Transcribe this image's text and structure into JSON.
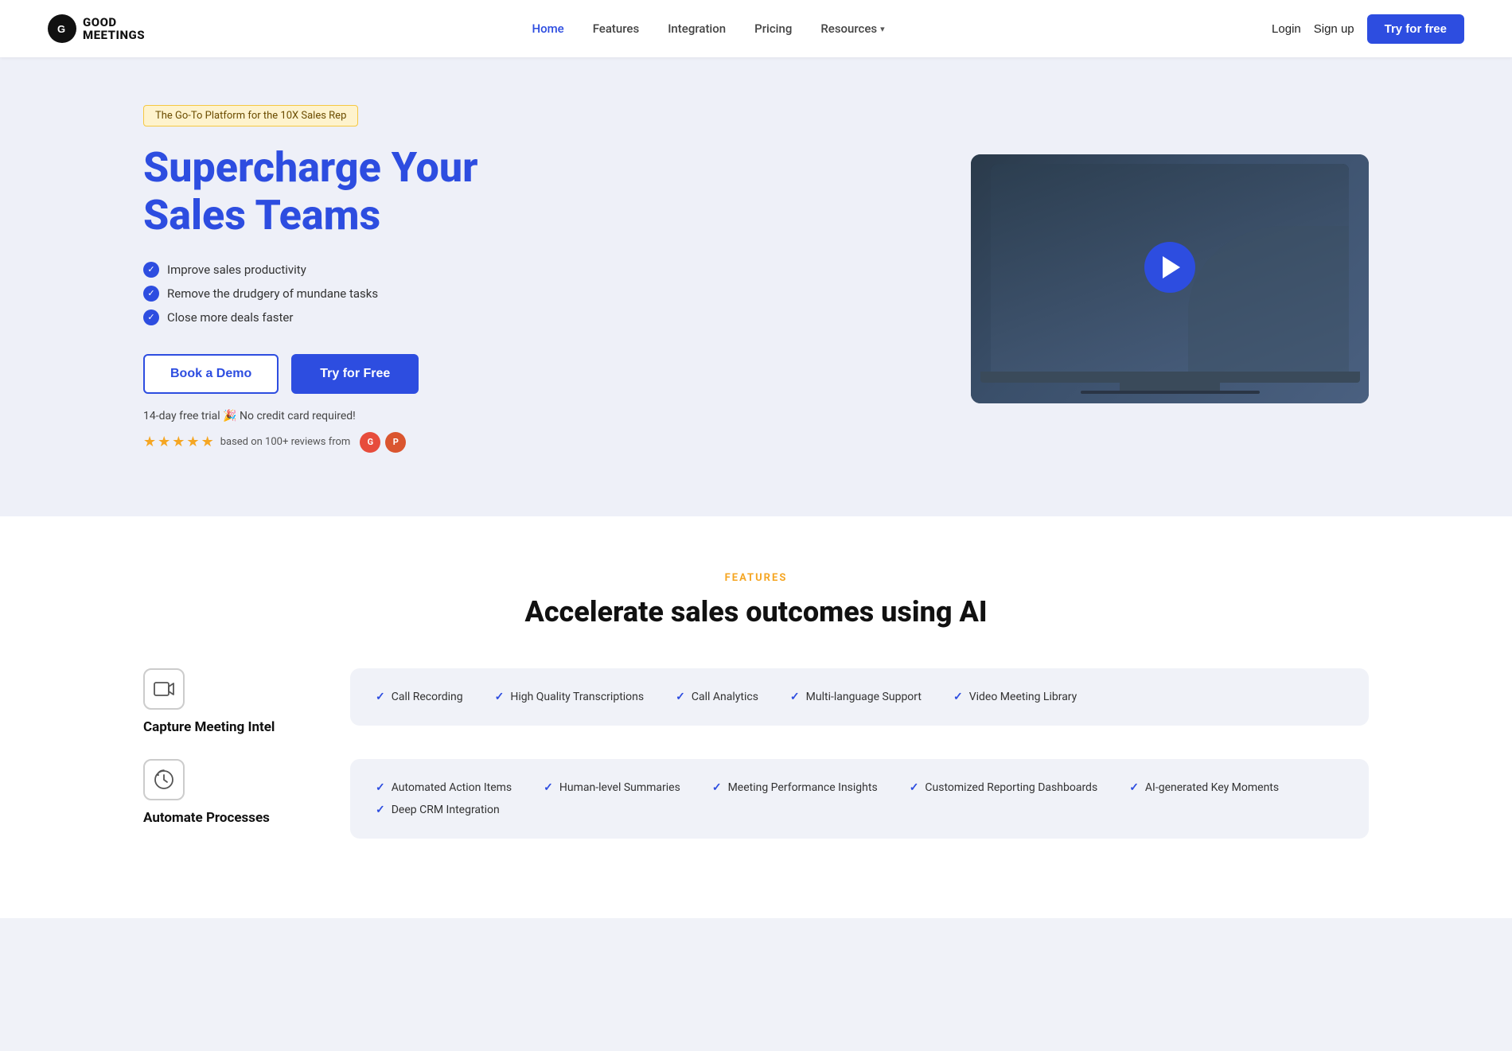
{
  "logo": {
    "icon": "G",
    "line1": "GOOD",
    "line2": "MEETINGS"
  },
  "nav": {
    "links": [
      {
        "id": "home",
        "label": "Home",
        "active": true
      },
      {
        "id": "features",
        "label": "Features",
        "active": false
      },
      {
        "id": "integration",
        "label": "Integration",
        "active": false
      },
      {
        "id": "pricing",
        "label": "Pricing",
        "active": false
      },
      {
        "id": "resources",
        "label": "Resources",
        "active": false
      }
    ],
    "login_label": "Login",
    "signup_label": "Sign up",
    "try_label": "Try for free"
  },
  "hero": {
    "badge": "The Go-To Platform for the 10X Sales Rep",
    "title_blue": "Supercharge",
    "title_rest": " Your Sales Teams",
    "features": [
      "Improve sales productivity",
      "Remove the drudgery of mundane tasks",
      "Close more deals faster"
    ],
    "btn_demo": "Book a Demo",
    "btn_try": "Try for Free",
    "trial_text": "14-day free trial 🎉  No credit card required!",
    "stars": 4.5,
    "reviews_text": "based on 100+ reviews from"
  },
  "features_section": {
    "label": "FEATURES",
    "title": "Accelerate sales outcomes using AI",
    "items": [
      {
        "id": "capture",
        "icon": "📹",
        "name": "Capture Meeting Intel",
        "tags": [
          "Call Recording",
          "High Quality Transcriptions",
          "Call Analytics",
          "Multi-language Support",
          "Video Meeting Library"
        ]
      },
      {
        "id": "automate",
        "icon": "🔄",
        "name": "Automate Processes",
        "tags": [
          "Automated Action Items",
          "Human-level Summaries",
          "Meeting Performance Insights",
          "Customized Reporting Dashboards",
          "AI-generated Key Moments",
          "Deep CRM Integration"
        ]
      }
    ]
  }
}
